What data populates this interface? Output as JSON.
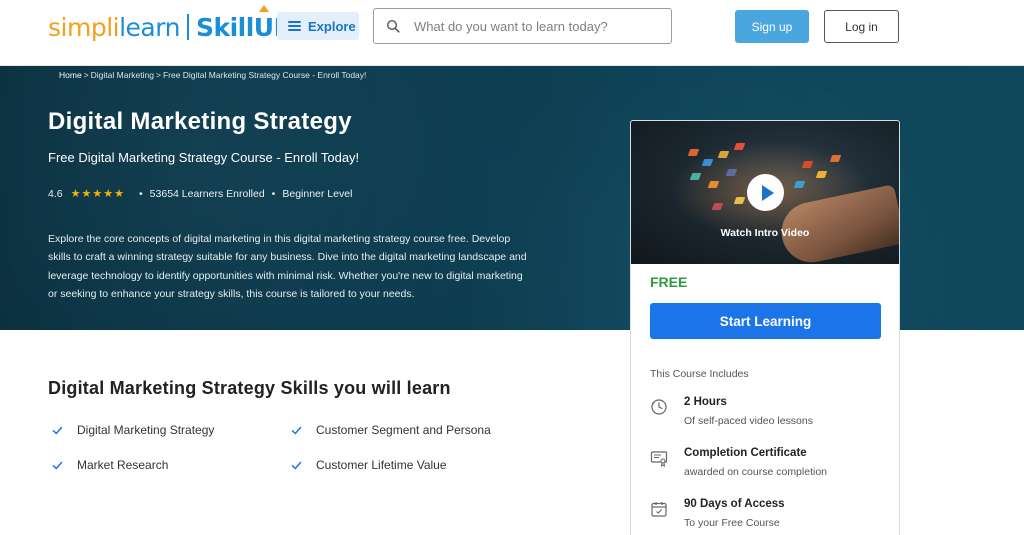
{
  "header": {
    "logo": {
      "simpli": "simpli",
      "learn": "learn",
      "skillup": "SkillUP"
    },
    "explore_label": "Explore",
    "search_placeholder": "What do you want to learn today?",
    "signup_label": "Sign up",
    "login_label": "Log in"
  },
  "breadcrumb": {
    "home": "Home",
    "sep1": ">",
    "category": "Digital Marketing",
    "sep2": ">",
    "current": "Free Digital Marketing Strategy Course - Enroll Today!"
  },
  "hero": {
    "title": "Digital Marketing Strategy",
    "subtitle": "Free Digital Marketing Strategy Course - Enroll Today!",
    "rating": "4.6",
    "stars": 5,
    "learners": "53654 Learners Enrolled",
    "level": "Beginner Level",
    "description": "Explore the core concepts of digital marketing in this digital marketing strategy course free. Develop skills to craft a winning strategy suitable for any business. Dive into the digital marketing landscape and leverage technology to identify opportunities with minimal risk. Whether you're new to digital marketing or seeking to enhance your strategy skills, this course is tailored to your needs."
  },
  "skills": {
    "title": "Digital Marketing Strategy Skills you will learn",
    "items": [
      "Digital Marketing Strategy",
      "Customer Segment and Persona",
      "Market Research",
      "Customer Lifetime Value"
    ]
  },
  "card": {
    "watch_label": "Watch Intro Video",
    "price": "FREE",
    "start_label": "Start Learning",
    "includes_title": "This Course Includes",
    "includes": [
      {
        "icon": "clock-icon",
        "title": "2 Hours",
        "sub": "Of self-paced video lessons"
      },
      {
        "icon": "certificate-icon",
        "title": "Completion Certificate",
        "sub": "awarded on course completion"
      },
      {
        "icon": "calendar-icon",
        "title": "90 Days of Access",
        "sub": "To your Free Course"
      }
    ]
  },
  "colors": {
    "brand_blue": "#1a8fd8",
    "brand_orange": "#f2a11f",
    "hero_bg": "#0d3c50",
    "cta_blue": "#1c74e9",
    "price_green": "#2e9c3f",
    "star": "#f5b400"
  }
}
